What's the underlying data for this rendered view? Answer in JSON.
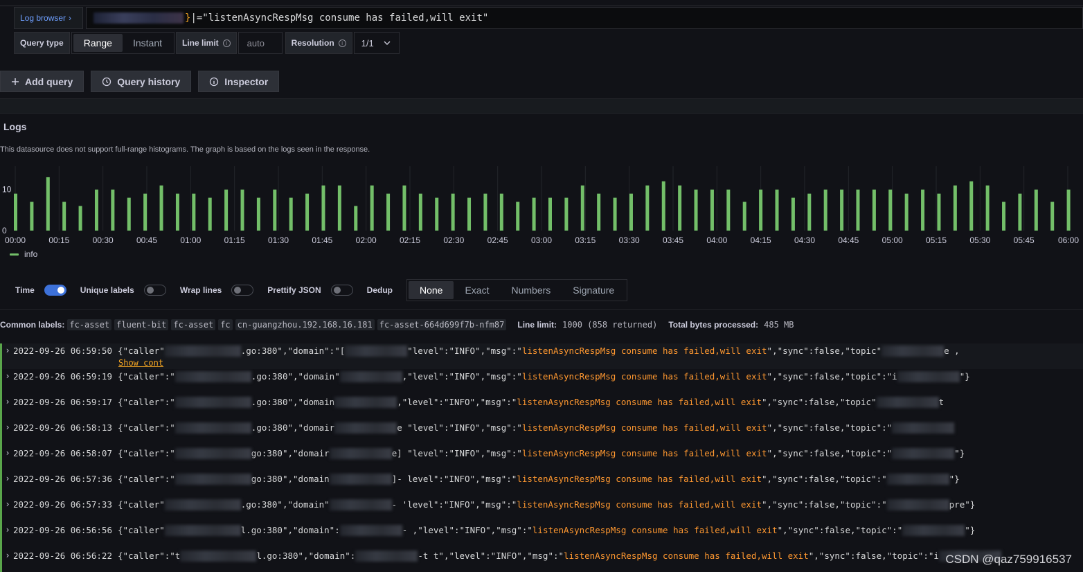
{
  "query": {
    "log_browser_label": "Log browser",
    "log_browser_chevron": "›",
    "expression_tail": "|=\"listenAsyncRespMsg consume has failed,will exit\"",
    "brace": "}"
  },
  "options": {
    "query_type_label": "Query type",
    "query_type_options": [
      "Range",
      "Instant"
    ],
    "query_type_selected": "Range",
    "line_limit_label": "Line limit",
    "line_limit_placeholder": "auto",
    "resolution_label": "Resolution",
    "resolution_value": "1/1"
  },
  "actions": {
    "add_query": "Add query",
    "query_history": "Query history",
    "inspector": "Inspector"
  },
  "logs_panel": {
    "title": "Logs",
    "note": "This datasource does not support full-range histograms. The graph is based on the logs seen in the response.",
    "legend": "info"
  },
  "chart_data": {
    "type": "bar",
    "series": [
      {
        "name": "info",
        "color": "#73bf69",
        "values": [
          9,
          7,
          13,
          7,
          6,
          10,
          10,
          8,
          9,
          11,
          9,
          9,
          8,
          10,
          10,
          8,
          10,
          8,
          9,
          11,
          11,
          6,
          11,
          9,
          11,
          9,
          8,
          9,
          8,
          9,
          9,
          7,
          8,
          8,
          8,
          11,
          9,
          8,
          9,
          11,
          12,
          11,
          10,
          10,
          10,
          7,
          10,
          10,
          8,
          9,
          10,
          10,
          10,
          10,
          10,
          9,
          10,
          9,
          11,
          12,
          11,
          7,
          9,
          10,
          7,
          10
        ]
      }
    ],
    "xticks": [
      "00:00",
      "00:15",
      "00:30",
      "00:45",
      "01:00",
      "01:15",
      "01:30",
      "01:45",
      "02:00",
      "02:15",
      "02:30",
      "02:45",
      "03:00",
      "03:15",
      "03:30",
      "03:45",
      "04:00",
      "04:15",
      "04:30",
      "04:45",
      "05:00",
      "05:15",
      "05:30",
      "05:45",
      "06:00"
    ],
    "yticks": [
      "0",
      "10"
    ],
    "ylim": [
      0,
      14
    ],
    "grid": true
  },
  "controls": {
    "time_label": "Time",
    "time_on": true,
    "unique_labels_label": "Unique labels",
    "wrap_lines_label": "Wrap lines",
    "prettify_json_label": "Prettify JSON",
    "dedup_label": "Dedup",
    "dedup_options": [
      "None",
      "Exact",
      "Numbers",
      "Signature"
    ],
    "dedup_selected": "None"
  },
  "meta": {
    "common_labels_label": "Common labels:",
    "common_labels": [
      "fc-asset",
      "fluent-bit",
      "fc-asset",
      "fc",
      "cn-guangzhou.192.168.16.181",
      "fc-asset-664d699f7b-nfm87"
    ],
    "line_limit_label": "Line limit:",
    "line_limit_value": "1000 (858 returned)",
    "total_bytes_label": "Total bytes processed:",
    "total_bytes_value": "485 MB"
  },
  "log_rows": [
    {
      "ts": "2022-09-26 06:59:50",
      "p1": "{\"caller\"",
      "p2": ".go:380\",\"domain\":\"[",
      "p3": "\"level\":\"INFO\",\"msg\":\"",
      "msg": "listenAsyncRespMsg consume has failed,will exit",
      "p4": "\",\"sync\":false,\"topic\"",
      "tail": "e  ,"
    },
    {
      "ts": "2022-09-26 06:59:19",
      "p1": "{\"caller\":\"",
      "p2": ".go:380\",\"domain\"",
      "p3": ",\"level\":\"INFO\",\"msg\":\"",
      "msg": "listenAsyncRespMsg consume has failed,will exit",
      "p4": "\",\"sync\":false,\"topic\":\"i",
      "tail": "\"}"
    },
    {
      "ts": "2022-09-26 06:59:17",
      "p1": "{\"caller\":\"",
      "p2": ".go:380\",\"domain",
      "p3": ",\"level\":\"INFO\",\"msg\":\"",
      "msg": "listenAsyncRespMsg consume has failed,will exit",
      "p4": "\",\"sync\":false,\"topic\"",
      "tail": "t"
    },
    {
      "ts": "2022-09-26 06:58:13",
      "p1": "{\"caller\":\"",
      "p2": ".go:380\",\"domair",
      "p3": "e  \"level\":\"INFO\",\"msg\":\"",
      "msg": "listenAsyncRespMsg consume has failed,will exit",
      "p4": "\",\"sync\":false,\"topic\":\"",
      "tail": ""
    },
    {
      "ts": "2022-09-26 06:58:07",
      "p1": "{\"caller\":\"",
      "p2": "go:380\",\"domair",
      "p3": "e]  \"level\":\"INFO\",\"msg\":\"",
      "msg": "listenAsyncRespMsg consume has failed,will exit",
      "p4": "\",\"sync\":false,\"topic\":\"",
      "tail": "\"}"
    },
    {
      "ts": "2022-09-26 06:57:36",
      "p1": "{\"caller\":\"",
      "p2": "go:380\",\"domain",
      "p3": "]-  level\":\"INFO\",\"msg\":\"",
      "msg": "listenAsyncRespMsg consume has failed,will exit",
      "p4": "\",\"sync\":false,\"topic\":\"",
      "tail": "\"}"
    },
    {
      "ts": "2022-09-26 06:57:33",
      "p1": "{\"caller\"",
      "p2": ".go:380\",\"domain\"",
      "p3": "-  'level\":\"INFO\",\"msg\":\"",
      "msg": "listenAsyncRespMsg consume has failed,will exit",
      "p4": "\",\"sync\":false,\"topic\":\"",
      "tail": "pre\"}"
    },
    {
      "ts": "2022-09-26 06:56:56",
      "p1": "{\"caller\"",
      "p2": "l.go:380\",\"domain\":",
      "p3": "-  ,\"level\":\"INFO\",\"msg\":\"",
      "msg": "listenAsyncRespMsg consume has failed,will exit",
      "p4": "\",\"sync\":false,\"topic\":\"",
      "tail": "\"}"
    },
    {
      "ts": "2022-09-26 06:56:22",
      "p1": "{\"caller\":\"t",
      "p2": "l.go:380\",\"domain\":",
      "p3": "-t  t\",\"level\":\"INFO\",\"msg\":\"",
      "msg": "listenAsyncRespMsg consume has failed,will exit",
      "p4": "\",\"sync\":false,\"topic\":\"i",
      "tail": ""
    }
  ],
  "show_context": "Show cont",
  "watermark": "CSDN @qaz759916537"
}
